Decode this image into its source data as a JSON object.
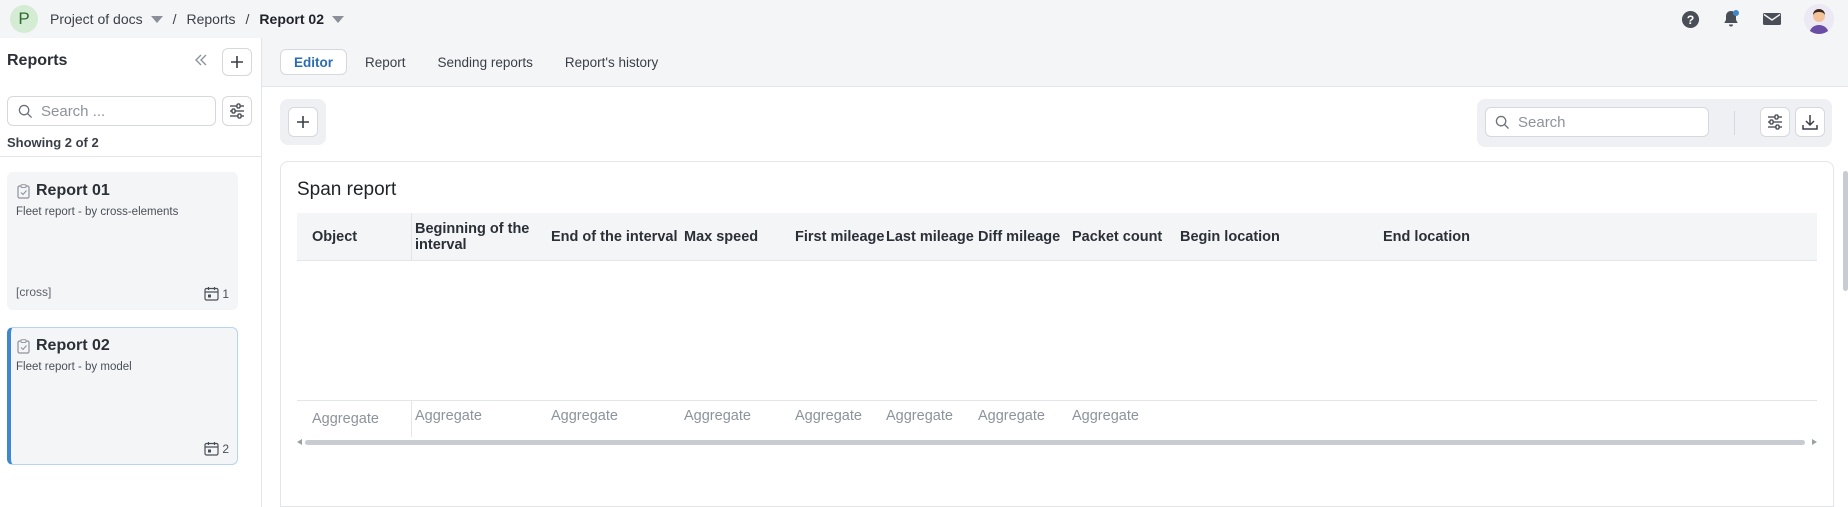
{
  "topbar": {
    "project_initial": "P",
    "breadcrumb": {
      "project": "Project of docs",
      "section": "Reports",
      "current": "Report 02",
      "separator": "/"
    }
  },
  "sidebar": {
    "title": "Reports",
    "search_placeholder": "Search ...",
    "showing": "Showing 2 of 2",
    "reports": [
      {
        "title": "Report 01",
        "subtitle": "Fleet report - by cross-elements",
        "tag": "[cross]",
        "count": "1",
        "active": false
      },
      {
        "title": "Report 02",
        "subtitle": "Fleet report - by model",
        "tag": "",
        "count": "2",
        "active": true
      }
    ]
  },
  "tabs": [
    {
      "label": "Editor",
      "active": true
    },
    {
      "label": "Report",
      "active": false
    },
    {
      "label": "Sending reports",
      "active": false
    },
    {
      "label": "Report's history",
      "active": false
    }
  ],
  "toolbar": {
    "search_placeholder": "Search"
  },
  "panel": {
    "title": "Span report",
    "columns": [
      "Object",
      "Beginning of the interval",
      "End of the interval",
      "Max speed",
      "First mileage",
      "Last mileage",
      "Diff mileage",
      "Packet count",
      "Begin location",
      "End location"
    ],
    "aggregates": [
      "Aggregate",
      "Aggregate",
      "Aggregate",
      "Aggregate",
      "Aggregate",
      "Aggregate",
      "Aggregate",
      "Aggregate"
    ]
  },
  "colors": {
    "accent": "#3d88cf",
    "tab_active": "#2a6db0",
    "surface": "#f4f5f7"
  }
}
